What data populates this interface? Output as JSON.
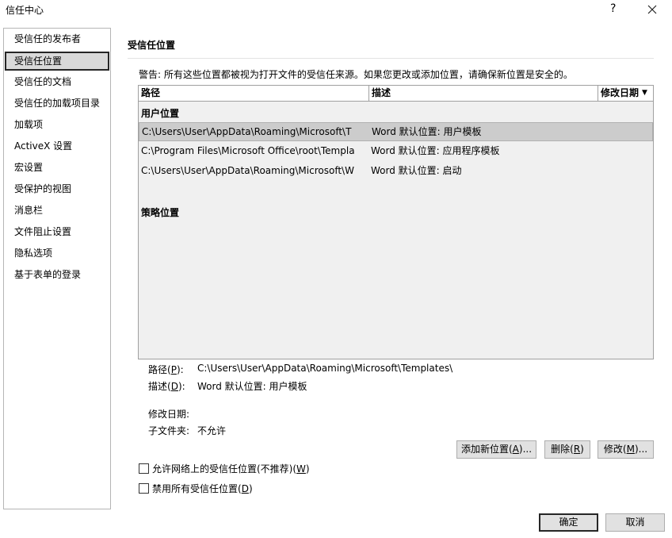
{
  "window": {
    "title": "信任中心",
    "help_glyph": "?"
  },
  "sidebar": {
    "items": [
      {
        "label": "受信任的发布者"
      },
      {
        "label": "受信任位置"
      },
      {
        "label": "受信任的文档"
      },
      {
        "label": "受信任的加载项目录"
      },
      {
        "label": "加载项"
      },
      {
        "label": "ActiveX 设置"
      },
      {
        "label": "宏设置"
      },
      {
        "label": "受保护的视图"
      },
      {
        "label": "消息栏"
      },
      {
        "label": "文件阻止设置"
      },
      {
        "label": "隐私选项"
      },
      {
        "label": "基于表单的登录"
      }
    ],
    "selected_index": 1
  },
  "main": {
    "section_title": "受信任位置",
    "warning": "警告: 所有这些位置都被视为打开文件的受信任来源。如果您更改或添加位置，请确保新位置是安全的。",
    "table": {
      "headers": {
        "path": "路径",
        "description": "描述",
        "modified": "修改日期"
      },
      "user_group_label": "用户位置",
      "rows": [
        {
          "path": "C:\\Users\\User\\AppData\\Roaming\\Microsoft\\T",
          "description": "Word 默认位置: 用户模板"
        },
        {
          "path": "C:\\Program Files\\Microsoft Office\\root\\Templa",
          "description": "Word 默认位置: 应用程序模板"
        },
        {
          "path": "C:\\Users\\User\\AppData\\Roaming\\Microsoft\\W",
          "description": "Word 默认位置: 启动"
        }
      ],
      "policy_group_label": "策略位置"
    },
    "details": {
      "path_label": "路径(",
      "path_key": "P",
      "path_label_end": "):",
      "path_value": "C:\\Users\\User\\AppData\\Roaming\\Microsoft\\Templates\\",
      "desc_label": "描述(",
      "desc_key": "D",
      "desc_label_end": "):",
      "desc_value": "Word 默认位置: 用户模板",
      "modified_label": "修改日期:",
      "subfolders_label": "子文件夹:",
      "subfolders_value": "不允许"
    },
    "buttons": {
      "add_pre": "添加新位置(",
      "add_key": "A",
      "add_post": ")...",
      "remove_pre": "删除(",
      "remove_key": "R",
      "remove_post": ")",
      "modify_pre": "修改(",
      "modify_key": "M",
      "modify_post": ")..."
    },
    "checkboxes": {
      "network_pre": "允许网络上的受信任位置(不推荐)(",
      "network_key": "W",
      "network_post": ")",
      "network_checked": false,
      "disable_pre": "禁用所有受信任位置(",
      "disable_key": "D",
      "disable_post": ")",
      "disable_checked": false
    }
  },
  "footer": {
    "ok_label": "确定",
    "cancel_label": "取消"
  }
}
